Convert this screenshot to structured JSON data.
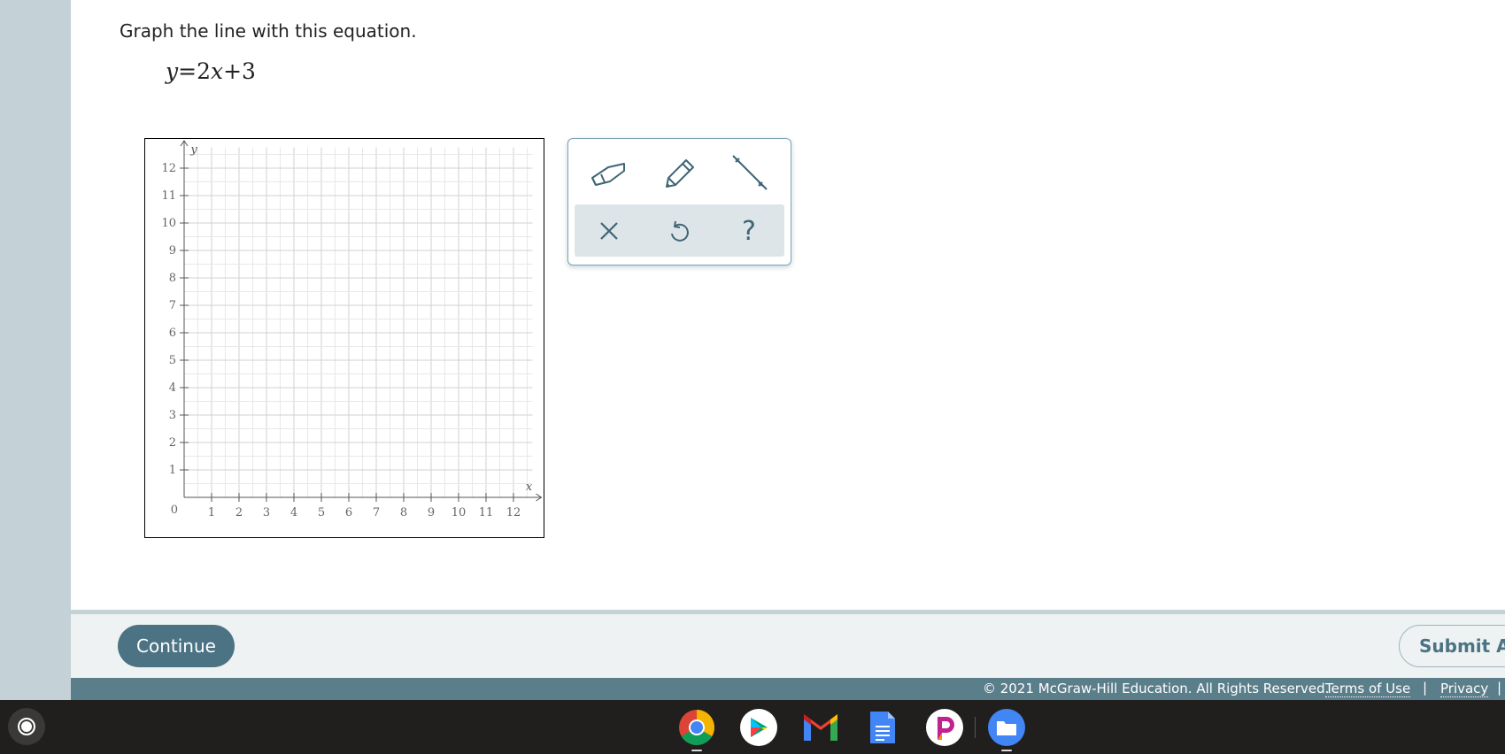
{
  "question": {
    "prompt": "Graph the line with this equation.",
    "equation": {
      "lhs": "y",
      "eq": "=",
      "coef": "2",
      "var": "x",
      "plus": "+",
      "const": "3"
    }
  },
  "graph": {
    "x_label": "x",
    "y_label": "y",
    "origin_label": "0",
    "x_ticks": [
      "1",
      "2",
      "3",
      "4",
      "5",
      "6",
      "7",
      "8",
      "9",
      "10",
      "11",
      "12"
    ],
    "y_ticks": [
      "1",
      "2",
      "3",
      "4",
      "5",
      "6",
      "7",
      "8",
      "9",
      "10",
      "11",
      "12"
    ],
    "xlim": [
      0,
      12.5
    ],
    "ylim": [
      0,
      12.5
    ],
    "grid": true,
    "line_color": "#4b7383"
  },
  "tools": {
    "eraser": "eraser-icon",
    "pencil": "pencil-icon",
    "line": "line-tool-icon",
    "clear": "x-icon",
    "undo": "undo-icon",
    "help": "?"
  },
  "actions": {
    "continue_label": "Continue",
    "submit_label": "Submit As"
  },
  "footer": {
    "copyright": "© 2021 McGraw-Hill Education. All Rights Reserved.",
    "terms": "Terms of Use",
    "sep": "|",
    "privacy": "Privacy"
  },
  "taskbar": {
    "apps": [
      "chrome-icon",
      "play-store-icon",
      "gmail-icon",
      "docs-icon",
      "picsart-icon",
      "files-icon"
    ]
  },
  "colors": {
    "accent": "#4b7383",
    "rail": "#c4d1d7",
    "footer": "#5b7e8b"
  }
}
